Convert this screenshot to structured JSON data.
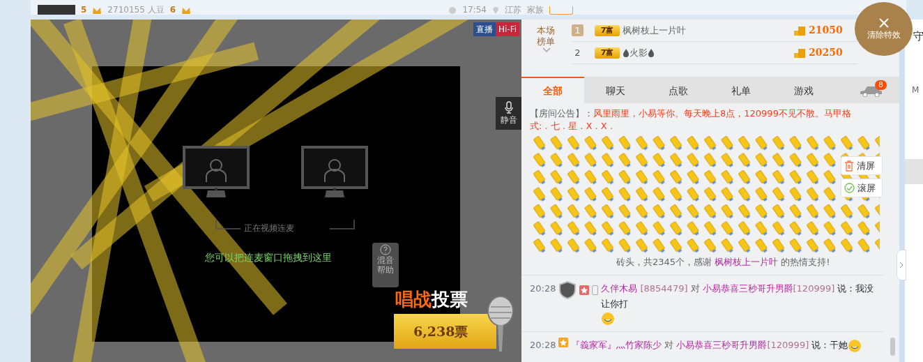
{
  "header": {
    "level_a": "5",
    "beans": "2710155 人豆",
    "level_b": "6",
    "time": "17:54",
    "location": "江苏",
    "family": "家族"
  },
  "video": {
    "badges": [
      {
        "text": "直播",
        "kind": "live"
      },
      {
        "text": "Hi-Fi",
        "kind": "hifi"
      }
    ],
    "mute_label": "静音",
    "link_status": "正在视频连麦",
    "drag_hint": "您可以把连麦窗口拖拽到这里",
    "help_label": "混音帮助",
    "vote_title_a": "唱战",
    "vote_title_b": "投票",
    "vote_count": "6,238票"
  },
  "clear_effects": "清除特效",
  "ranking": {
    "label": "本场榜单",
    "rows": [
      {
        "rank": "1",
        "highlighted": true,
        "level": "7富",
        "name": "枫树枝上一片叶",
        "flames": false,
        "score": "21050"
      },
      {
        "rank": "2",
        "highlighted": false,
        "level": "7富",
        "name": "火影",
        "flames": true,
        "score": "20250"
      }
    ]
  },
  "tabs": [
    {
      "label": "全部",
      "selected": true
    },
    {
      "label": "聊天",
      "selected": false
    },
    {
      "label": "点歌",
      "selected": false
    },
    {
      "label": "礼单",
      "selected": false
    },
    {
      "label": "游戏",
      "selected": false
    }
  ],
  "car_badge": "8",
  "announcement": {
    "label": "【房间公告】：",
    "text": "风里雨里，小易等你。每天晚上8点，120999不见不散。马甲格式: . 七 . 星 . X . X ."
  },
  "gift_notice": {
    "text": "砖头，共2345个，感谢",
    "sender": "枫树枝上一片叶",
    "suffix": "的热情支持!"
  },
  "tools": [
    {
      "label": "清屏",
      "kind": "clear"
    },
    {
      "label": "滚屏",
      "kind": "scroll",
      "checked": true
    }
  ],
  "messages": [
    {
      "time": "20:28",
      "guard": true,
      "sender": "久伴木易",
      "sender_id": "[8854479]",
      "to": "对",
      "recipient": "小易恭喜三秒哥升男爵",
      "recipient_id": "[120999]",
      "says": "说：我没让你打"
    },
    {
      "time": "20:28",
      "guard": false,
      "sender": "『義家军』灬竹家陈少",
      "to": "对",
      "recipient": "小易恭喜三秒哥升男爵",
      "recipient_id": "[120999]",
      "says": "说：干她"
    }
  ],
  "side": {
    "title": "守",
    "letter": "M"
  }
}
